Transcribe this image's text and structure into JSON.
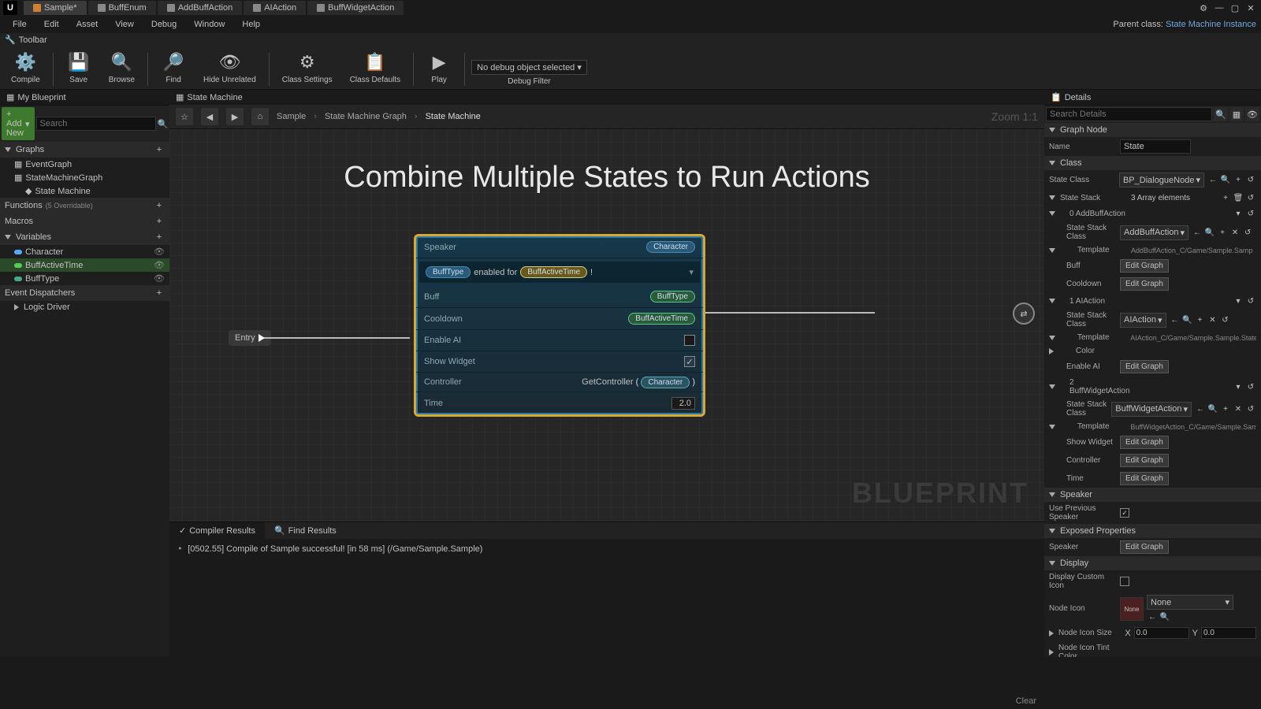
{
  "titlebar": {
    "tabs": [
      {
        "label": "Sample*",
        "active": true
      },
      {
        "label": "BuffEnum"
      },
      {
        "label": "AddBuffAction"
      },
      {
        "label": "AIAction"
      },
      {
        "label": "BuffWidgetAction"
      }
    ]
  },
  "menubar": {
    "items": [
      "File",
      "Edit",
      "Asset",
      "View",
      "Debug",
      "Window",
      "Help"
    ],
    "parent_label": "Parent class:",
    "parent_value": "State Machine Instance"
  },
  "toolbar": {
    "header": "Toolbar",
    "items": [
      "Compile",
      "Save",
      "Browse",
      "Find",
      "Hide Unrelated",
      "Class Settings",
      "Class Defaults",
      "Play"
    ],
    "debug_select": "No debug object selected",
    "debug_filter": "Debug Filter"
  },
  "left": {
    "tab": "My Blueprint",
    "add_new": "+ Add New",
    "search_placeholder": "Search",
    "sections": {
      "graphs": "Graphs",
      "functions": "Functions",
      "functions_note": "(5 Overridable)",
      "macros": "Macros",
      "variables": "Variables",
      "event_dispatchers": "Event Dispatchers"
    },
    "graphs_items": [
      "EventGraph",
      "StateMachineGraph",
      "State Machine"
    ],
    "variables_items": [
      "Character",
      "BuffActiveTime",
      "BuffType"
    ],
    "logic_driver": "Logic Driver"
  },
  "center": {
    "sub_tab": "State Machine",
    "breadcrumb": [
      "Sample",
      "State Machine Graph",
      "State Machine"
    ],
    "zoom": "Zoom 1:1",
    "big_title": "Combine Multiple States to Run Actions",
    "blueprint_wm": "BLUEPRINT",
    "entry": "Entry",
    "node": {
      "speaker": "Speaker",
      "speaker_val": "Character",
      "text_pre": "BuffType",
      "text_mid": " enabled for ",
      "text_chip": "BuffActiveTime",
      "text_end": " !",
      "buff": "Buff",
      "buff_val": "BuffType",
      "cooldown": "Cooldown",
      "cooldown_val": "BuffActiveTime",
      "enable_ai": "Enable AI",
      "show_widget": "Show Widget",
      "controller": "Controller",
      "controller_val": "GetController",
      "controller_arg": "Character",
      "time": "Time",
      "time_val": "2.0"
    }
  },
  "bottom": {
    "tabs": [
      "Compiler Results",
      "Find Results"
    ],
    "log": "[0502.55] Compile of Sample successful! [in 58 ms] (/Game/Sample.Sample)",
    "clear": "Clear"
  },
  "details": {
    "tab": "Details",
    "search_placeholder": "Search Details",
    "graph_node": {
      "header": "Graph Node",
      "name_label": "Name",
      "name_val": "State"
    },
    "class": {
      "header": "Class",
      "state_class": "State Class",
      "state_class_val": "BP_DialogueNode",
      "state_stack": "State Stack",
      "stack_note": "3 Array elements",
      "item0": "0 AddBuffAction",
      "item0_class": "State Stack Class",
      "item0_class_val": "AddBuffAction",
      "template": "Template",
      "template0_val": "AddBuffAction_C/Game/Sample.Samp",
      "buff": "Buff",
      "cooldown": "Cooldown",
      "item1": "1 AIAction",
      "item1_class_val": "AIAction",
      "template1_val": "AIAction_C/Game/Sample.Sample.State",
      "color": "Color",
      "enable_ai": "Enable AI",
      "item2": "2 BuffWidgetAction",
      "item2_class_val": "BuffWidgetAction",
      "template2_val": "BuffWidgetAction_C/Game/Sample.Sam",
      "show_widget": "Show Widget",
      "controller": "Controller",
      "time": "Time",
      "edit_graph": "Edit Graph"
    },
    "speaker": {
      "header": "Speaker",
      "use_prev": "Use Previous Speaker"
    },
    "exposed": {
      "header": "Exposed Properties",
      "speaker": "Speaker"
    },
    "display": {
      "header": "Display",
      "custom_icon": "Display Custom Icon",
      "node_icon": "Node Icon",
      "none": "None",
      "icon_size": "Node Icon Size",
      "x": "X",
      "x_val": "0.0",
      "y": "Y",
      "y_val": "0.0",
      "tint": "Node Icon Tint Color"
    }
  }
}
